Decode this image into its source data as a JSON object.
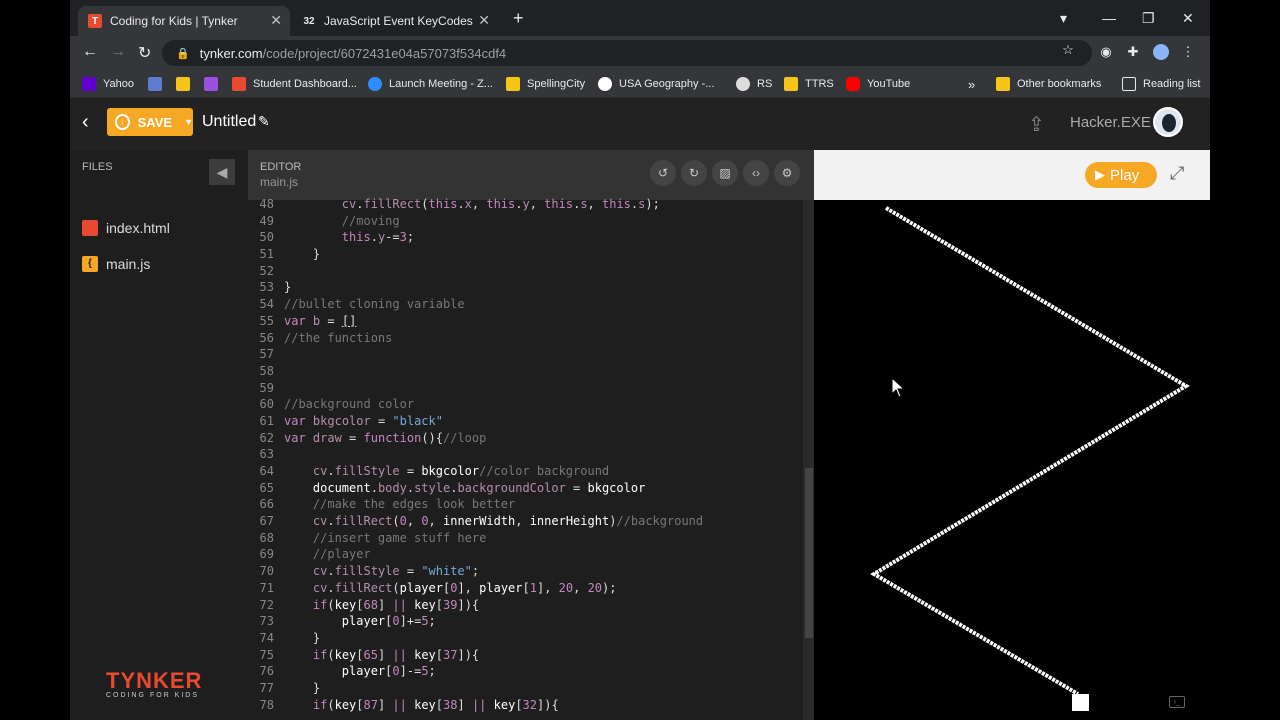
{
  "browser": {
    "tabs": [
      {
        "title": "Coding for Kids | Tynker",
        "favicon": "T"
      },
      {
        "title": "JavaScript Event KeyCodes",
        "favicon": "32"
      }
    ],
    "new_tab": "+",
    "url_host": "tynker.com",
    "url_path": "/code/project/6072431e04a57073f534cdf4"
  },
  "bookmarks": [
    {
      "label": "Yahoo",
      "color": "#6001d2"
    },
    {
      "label": "Student Dashboard...",
      "color": "#e8492f"
    },
    {
      "label": "Launch Meeting - Z...",
      "color": "#2d8cff"
    },
    {
      "label": "SpellingCity",
      "color": "#f5c518"
    },
    {
      "label": "USA Geography -...",
      "color": "#ffffff"
    },
    {
      "label": "RS",
      "color": "#dddddd"
    },
    {
      "label": "TTRS",
      "color": "#f5c518"
    },
    {
      "label": "YouTube",
      "color": "#ff0000"
    }
  ],
  "bookmarks_more": "»",
  "other_bookmarks": "Other bookmarks",
  "reading_list": "Reading list",
  "app": {
    "save_label": "SAVE",
    "project_title": "Untitled",
    "username": "Hacker.EXE"
  },
  "files": {
    "title": "FILES",
    "items": [
      {
        "name": "index.html",
        "color": "#e8492f",
        "glyph": ""
      },
      {
        "name": "main.js",
        "color": "#f6a724",
        "glyph": "{"
      }
    ]
  },
  "logo": {
    "word": "TYNKER",
    "tagline": "CODING FOR KIDS"
  },
  "editor": {
    "label": "EDITOR",
    "filename": "main.js",
    "lines": [
      {
        "n": "48",
        "html": "        <span class='c-fn'>cv</span>.<span class='c-fn'>fillRect</span>(<span class='c-kw'>this</span>.<span class='c-fn'>x</span>, <span class='c-kw'>this</span>.<span class='c-fn'>y</span>, <span class='c-kw'>this</span>.<span class='c-fn'>s</span>, <span class='c-kw'>this</span>.<span class='c-fn'>s</span>);"
      },
      {
        "n": "49",
        "html": "        <span class='c-cm'>//moving</span>"
      },
      {
        "n": "50",
        "html": "        <span class='c-kw'>this</span>.<span class='c-fn'>y</span>-=<span class='c-nm'>3</span>;"
      },
      {
        "n": "51",
        "html": "    }"
      },
      {
        "n": "52",
        "html": ""
      },
      {
        "n": "53",
        "html": "}"
      },
      {
        "n": "54",
        "html": "<span class='c-cm'>//bullet cloning variable</span>"
      },
      {
        "n": "55",
        "html": "<span class='c-kw'>var</span> <span class='c-fn'>b</span> = <span style='text-decoration:underline'>[]</span>"
      },
      {
        "n": "56",
        "html": "<span class='c-cm'>//the functions</span>"
      },
      {
        "n": "57",
        "html": ""
      },
      {
        "n": "58",
        "html": ""
      },
      {
        "n": "59",
        "html": ""
      },
      {
        "n": "60",
        "html": "<span class='c-cm'>//background color</span>"
      },
      {
        "n": "61",
        "html": "<span class='c-kw'>var</span> <span class='c-fn'>bkgcolor</span> = <span class='c-st'>\"black\"</span>"
      },
      {
        "n": "62",
        "html": "<span class='c-kw'>var</span> <span class='c-fn'>draw</span> = <span class='c-kw'>function</span>(){<span class='c-cm'>//loop</span>"
      },
      {
        "n": "63",
        "html": ""
      },
      {
        "n": "64",
        "html": "    <span class='c-fn'>cv</span>.<span class='c-fn'>fillStyle</span> = <span class='c-id'>bkgcolor</span><span class='c-cm'>//color background</span>"
      },
      {
        "n": "65",
        "html": "    <span class='c-id'>document</span>.<span class='c-fn'>body</span>.<span class='c-fn'>style</span>.<span class='c-fn'>backgroundColor</span> = <span class='c-id'>bkgcolor</span>"
      },
      {
        "n": "66",
        "html": "    <span class='c-cm'>//make the edges look better</span>"
      },
      {
        "n": "67",
        "html": "    <span class='c-fn'>cv</span>.<span class='c-fn'>fillRect</span>(<span class='c-nm'>0</span>, <span class='c-nm'>0</span>, <span class='c-id'>innerWidth</span>, <span class='c-id'>innerHeight</span>)<span class='c-cm'>//background</span>"
      },
      {
        "n": "68",
        "html": "    <span class='c-cm'>//insert game stuff here</span>"
      },
      {
        "n": "69",
        "html": "    <span class='c-cm'>//player</span>"
      },
      {
        "n": "70",
        "html": "    <span class='c-fn'>cv</span>.<span class='c-fn'>fillStyle</span> = <span class='c-st'>\"white\"</span>;"
      },
      {
        "n": "71",
        "html": "    <span class='c-fn'>cv</span>.<span class='c-fn'>fillRect</span>(<span class='c-id'>player</span>[<span class='c-nm'>0</span>], <span class='c-id'>player</span>[<span class='c-nm'>1</span>], <span class='c-nm'>20</span>, <span class='c-nm'>20</span>);"
      },
      {
        "n": "72",
        "html": "    <span class='c-kw'>if</span>(<span class='c-id'>key</span>[<span class='c-nm'>68</span>] <span class='c-kw'>||</span> <span class='c-id'>key</span>[<span class='c-nm'>39</span>]){"
      },
      {
        "n": "73",
        "html": "        <span class='c-id'>player</span>[<span class='c-nm'>0</span>]+=<span class='c-nm'>5</span>;"
      },
      {
        "n": "74",
        "html": "    }"
      },
      {
        "n": "75",
        "html": "    <span class='c-kw'>if</span>(<span class='c-id'>key</span>[<span class='c-nm'>65</span>] <span class='c-kw'>||</span> <span class='c-id'>key</span>[<span class='c-nm'>37</span>]){"
      },
      {
        "n": "76",
        "html": "        <span class='c-id'>player</span>[<span class='c-nm'>0</span>]-=<span class='c-nm'>5</span>;"
      },
      {
        "n": "77",
        "html": "    }"
      },
      {
        "n": "78",
        "html": "    <span class='c-kw'>if</span>(<span class='c-id'>key</span>[<span class='c-nm'>87</span>] <span class='c-kw'>||</span> <span class='c-id'>key</span>[<span class='c-nm'>38</span>] <span class='c-kw'>||</span> <span class='c-id'>key</span>[<span class='c-nm'>32</span>]){"
      }
    ]
  },
  "preview": {
    "play_label": "Play",
    "background": "#000000",
    "line_color": "#ffffff"
  }
}
